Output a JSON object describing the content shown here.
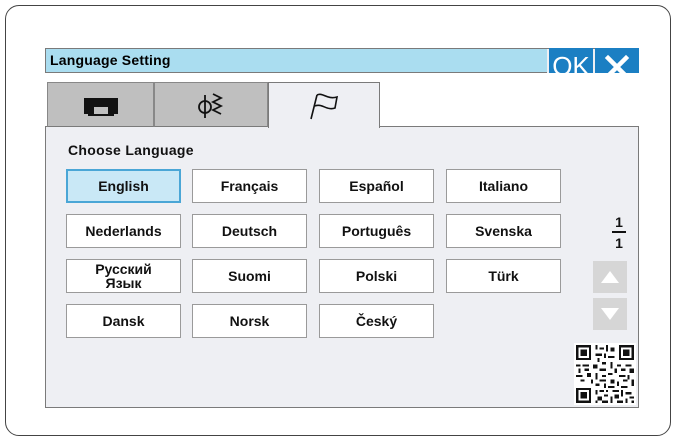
{
  "window": {
    "title": "Language Setting",
    "ok_label": "OK"
  },
  "tabs": [
    {
      "icon": "sewing-machine-icon"
    },
    {
      "icon": "stitch-pattern-icon"
    },
    {
      "icon": "flag-icon",
      "active": true
    }
  ],
  "section": {
    "heading": "Choose Language"
  },
  "languages": [
    "English",
    "Français",
    "Español",
    "Italiano",
    "Nederlands",
    "Deutsch",
    "Português",
    "Svenska",
    "Русский Язык",
    "Suomi",
    "Polski",
    "Türk",
    "Dansk",
    "Norsk",
    "Český"
  ],
  "selected_language": "English",
  "pagination": {
    "current": "1",
    "total": "1"
  },
  "colors": {
    "accent": "#1b7fc3",
    "title_bar": "#aaddf0",
    "selected_bg": "#c9e8f6"
  }
}
